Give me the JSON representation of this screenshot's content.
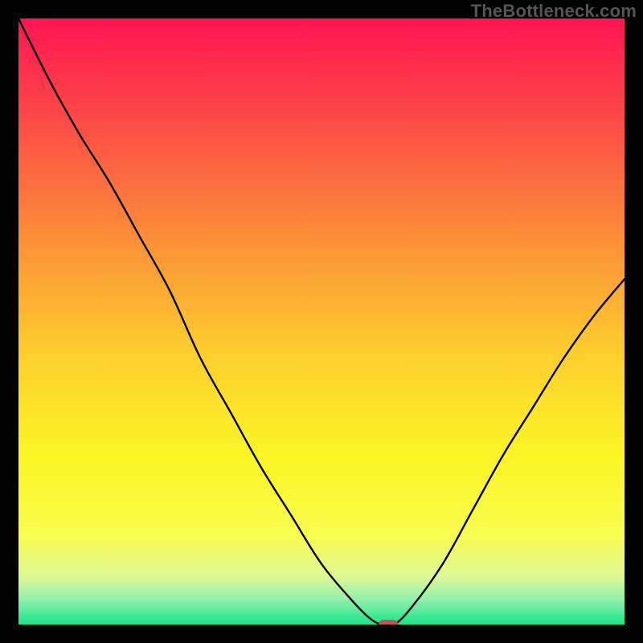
{
  "watermark": "TheBottleneck.com",
  "chart_data": {
    "type": "line",
    "title": "",
    "xlabel": "",
    "ylabel": "",
    "xlim": [
      0,
      100
    ],
    "ylim": [
      0,
      100
    ],
    "x": [
      0,
      5,
      10,
      15,
      20,
      25,
      30,
      35,
      40,
      45,
      50,
      55,
      58,
      60,
      62,
      65,
      70,
      75,
      80,
      85,
      90,
      95,
      100
    ],
    "values": [
      100,
      90,
      81,
      73,
      64,
      55,
      44,
      35,
      26,
      18,
      10,
      4,
      1,
      0,
      0,
      3,
      10,
      19,
      28,
      36,
      44,
      51,
      57
    ],
    "marker": {
      "x": 61,
      "y": 0,
      "shape": "rounded-rect",
      "color": "#c15752"
    },
    "background_gradient": {
      "direction": "vertical",
      "stops": [
        {
          "pos": 0.0,
          "color": "#fe1552"
        },
        {
          "pos": 0.17,
          "color": "#fd4b46"
        },
        {
          "pos": 0.35,
          "color": "#fc8a39"
        },
        {
          "pos": 0.55,
          "color": "#fcce2d"
        },
        {
          "pos": 0.72,
          "color": "#fbf525"
        },
        {
          "pos": 0.85,
          "color": "#f8fc4d"
        },
        {
          "pos": 0.92,
          "color": "#e0f996"
        },
        {
          "pos": 0.96,
          "color": "#8df0ac"
        },
        {
          "pos": 1.0,
          "color": "#18e588"
        }
      ]
    }
  }
}
